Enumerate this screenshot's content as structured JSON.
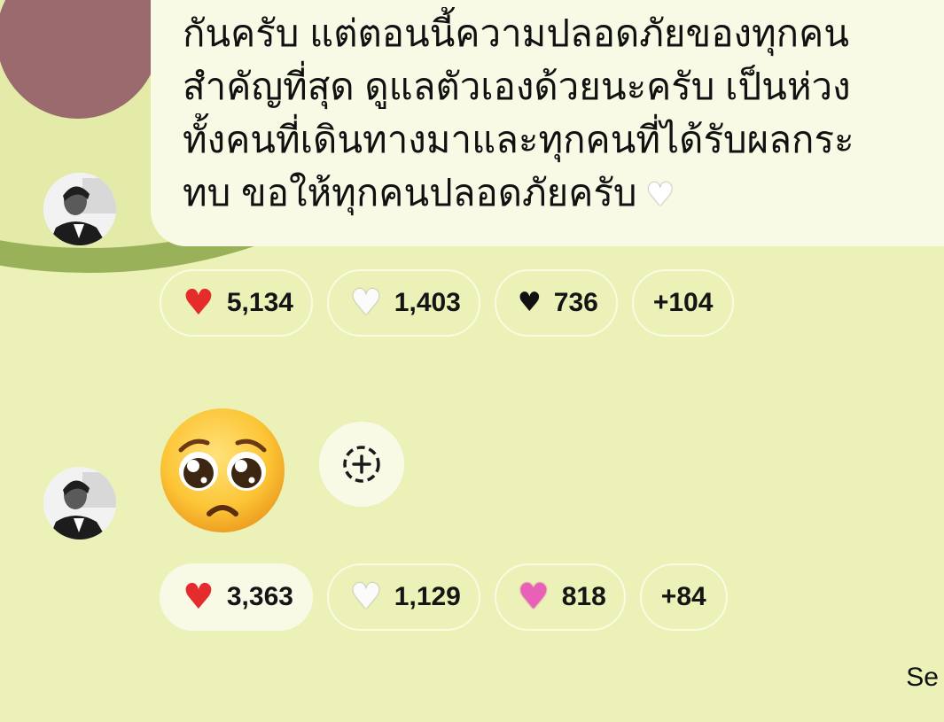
{
  "message1": {
    "lines": [
      "กันครับ แต่ตอนนี้ความปลอดภัยของทุกคน",
      "สำคัญที่สุด ดูแลตัวเองด้วยนะครับ เป็นห่วง",
      "ทั้งคนที่เดินทางมาและทุกคนที่ได้รับผลกระ",
      "ทบ ขอให้ทุกคนปลอดภัยครับ"
    ],
    "trailing_emoji": "white-heart-emoji",
    "reactions": [
      {
        "icon": "red-heart",
        "count": "5,134",
        "selected": false
      },
      {
        "icon": "white-heart",
        "count": "1,403",
        "selected": false
      },
      {
        "icon": "black-heart",
        "count": "736",
        "selected": false
      },
      {
        "more": "+104"
      }
    ]
  },
  "message2": {
    "emoji": "pleading-face-emoji",
    "reactions": [
      {
        "icon": "red-heart",
        "count": "3,363",
        "selected": true
      },
      {
        "icon": "white-heart",
        "count": "1,129",
        "selected": false
      },
      {
        "icon": "growing-heart",
        "count": "818",
        "selected": false
      },
      {
        "more": "+84"
      }
    ]
  },
  "footer_text": "Se",
  "colors": {
    "background": "#ecf1b8",
    "bubble": "#f9fae6",
    "circle_mauve": "#9a6a6e",
    "arc_green": "#99b25a",
    "red_heart": "#e52c2c",
    "pink_heart": "#ea5fb8"
  }
}
